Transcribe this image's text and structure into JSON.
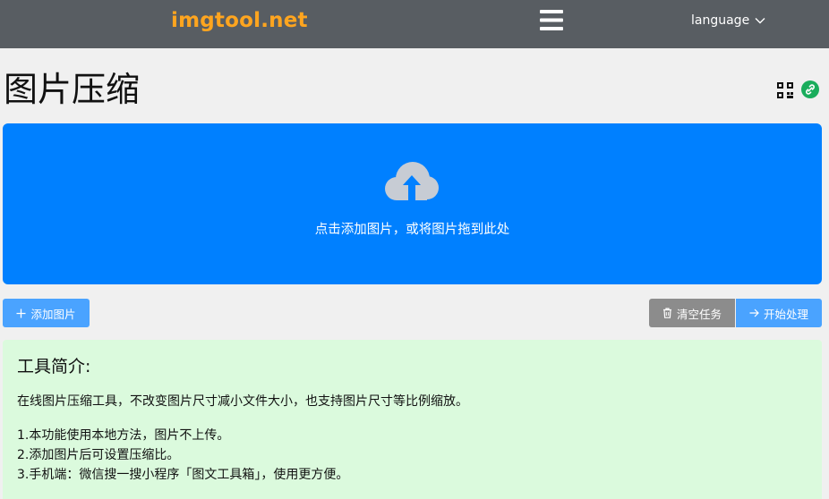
{
  "header": {
    "logo": "imgtool.net",
    "language_label": "language"
  },
  "page": {
    "title": "图片压缩"
  },
  "dropzone": {
    "text": "点击添加图片，或将图片拖到此处"
  },
  "toolbar": {
    "add_label": "添加图片",
    "clear_label": "清空任务",
    "start_label": "开始处理"
  },
  "intro": {
    "title": "工具简介:",
    "description": "在线图片压缩工具，不改变图片尺寸减小文件大小，也支持图片尺寸等比例缩放。",
    "items": [
      "1.本功能使用本地方法，图片不上传。",
      "2.添加图片后可设置压缩比。",
      "3.手机端：微信搜一搜小程序「图文工具箱」，使用更方便。"
    ]
  },
  "colors": {
    "topbar": "#585d62",
    "logo": "#ffa51f",
    "dropzone": "#0080ff",
    "primary_button": "#4aa3ff",
    "clear_button": "#8c8c8c",
    "intro_background": "#dbfadd",
    "link_icon": "#1aad5c"
  },
  "icons": [
    "hamburger-menu-icon",
    "chevron-down-icon",
    "qr-code-icon",
    "link-icon",
    "cloud-upload-icon",
    "plus-icon",
    "trash-icon",
    "arrow-right-icon"
  ]
}
